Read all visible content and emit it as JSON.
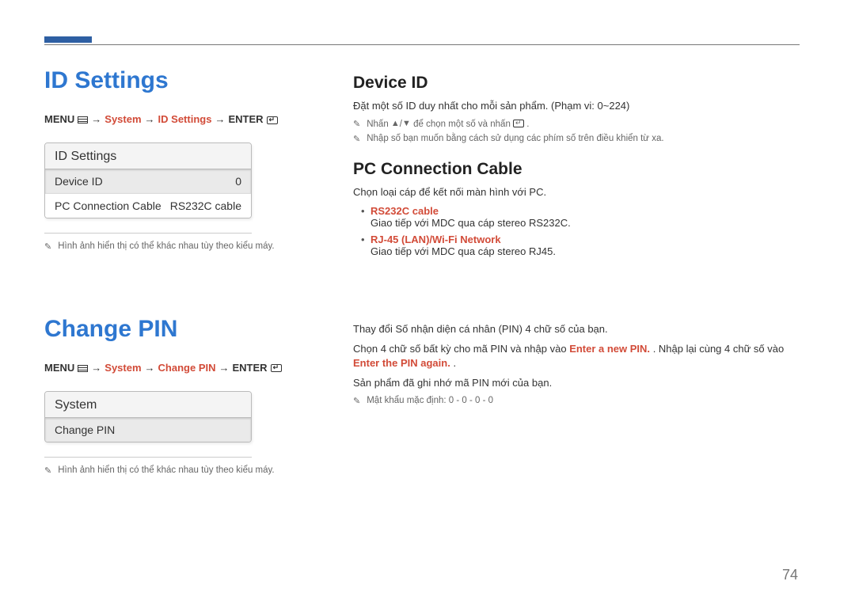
{
  "page_number": "74",
  "id_settings": {
    "title": "ID Settings",
    "breadcrumb": {
      "b_menu": "MENU",
      "b_system": "System",
      "b_idsettings": "ID Settings",
      "b_enter": "ENTER"
    },
    "panel": {
      "header": "ID Settings",
      "device_id_label": "Device ID",
      "device_id_value": "0",
      "pc_cable_label": "PC Connection Cable",
      "pc_cable_value": "RS232C cable"
    },
    "footnote": "Hình ảnh hiển thị có thể khác nhau tùy theo kiểu máy.",
    "right": {
      "device_id_title": "Device ID",
      "device_id_desc": "Đặt một số ID duy nhất cho mỗi sản phẩm. (Phạm vi: 0~224)",
      "note1_prefix": "Nhấn ",
      "note1_suffix": " để chọn một số và nhấn ",
      "note1_tail": ".",
      "note2": "Nhập số bạn muốn bằng cách sử dụng các phím số trên điều khiển từ xa.",
      "pc_cable_title": "PC Connection Cable",
      "pc_cable_desc": "Chọn loại cáp để kết nối màn hình với PC.",
      "bullet1_title": "RS232C cable",
      "bullet1_body": "Giao tiếp với MDC qua cáp stereo RS232C.",
      "bullet2_title": "RJ-45 (LAN)/Wi-Fi Network",
      "bullet2_body": "Giao tiếp với MDC qua cáp stereo RJ45."
    }
  },
  "change_pin": {
    "title": "Change PIN",
    "breadcrumb": {
      "b_menu": "MENU",
      "b_system": "System",
      "b_changepin": "Change PIN",
      "b_enter": "ENTER"
    },
    "panel": {
      "header": "System",
      "row1": "Change PIN"
    },
    "footnote": "Hình ảnh hiển thị có thể khác nhau tùy theo kiểu máy.",
    "right": {
      "line1": "Thay đổi Số nhận diện cá nhân (PIN) 4 chữ số của bạn.",
      "line2_a": "Chọn 4 chữ số bất kỳ cho mã PIN và nhập vào ",
      "line2_red1": "Enter a new PIN.",
      "line2_b": ". Nhập lại cùng 4 chữ số vào ",
      "line2_red2": "Enter the PIN again.",
      "line2_c": ".",
      "line3": "Sản phẩm đã ghi nhớ mã PIN mới của bạn.",
      "note_default": "Mật khẩu mặc định: 0 - 0 - 0 - 0"
    }
  }
}
